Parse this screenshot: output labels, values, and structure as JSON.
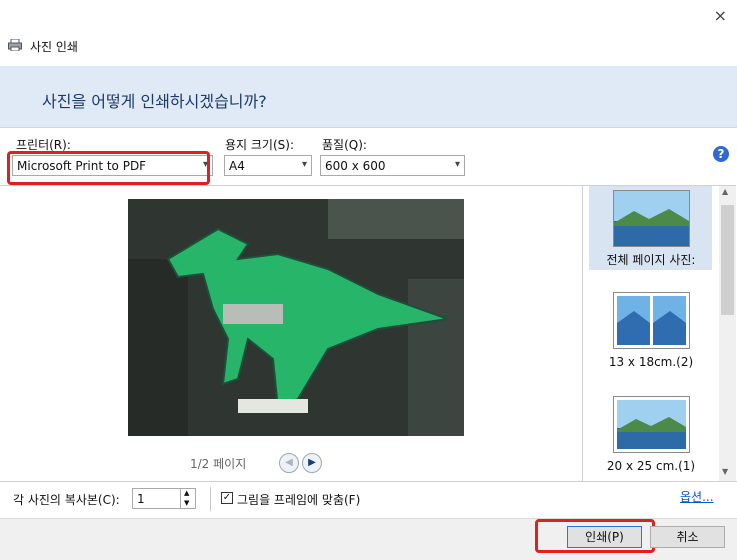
{
  "window": {
    "title": "사진 인쇄",
    "close": "×"
  },
  "banner": {
    "question": "사진을 어떻게 인쇄하시겠습니까?"
  },
  "printer": {
    "label": "프린터(R):",
    "value": "Microsoft Print to PDF"
  },
  "paper": {
    "label": "용지 크기(S):",
    "value": "A4"
  },
  "quality": {
    "label": "품질(Q):",
    "value": "600 x 600"
  },
  "help": "?",
  "preview": {
    "page": "1/2 페이지"
  },
  "layouts": [
    {
      "label": "전체 페이지 사진:"
    },
    {
      "label": "13 x 18cm.(2)"
    },
    {
      "label": "20 x 25 cm.(1)"
    }
  ],
  "copies": {
    "label": "각 사진의 복사본(C):",
    "value": "1"
  },
  "fit": {
    "label": "그림을 프레임에 맞춤(F)",
    "checked_mark": "✓"
  },
  "options_link": "옵션...",
  "buttons": {
    "print": "인쇄(P)",
    "cancel": "취소"
  },
  "colors": {
    "highlight": "#e02020",
    "banner": "#dfeaf6",
    "accent": "#2a79d0"
  }
}
